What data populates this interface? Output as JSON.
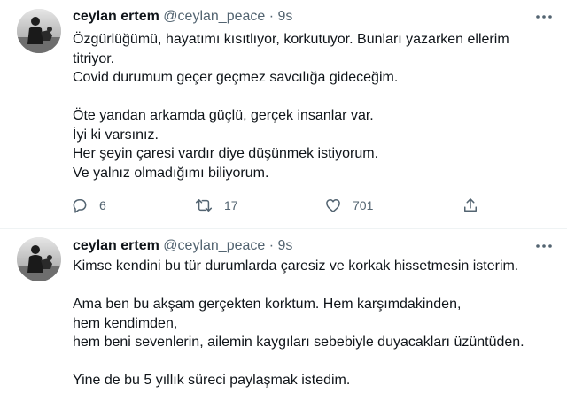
{
  "tweets": [
    {
      "name": "ceylan ertem",
      "handle": "@ceylan_peace",
      "separator": "·",
      "time": "9s",
      "lines": [
        "Özgürlüğümü, hayatımı kısıtlıyor, korkutuyor. Bunları yazarken ellerim",
        "titriyor.",
        "Covid durumum geçer geçmez savcılığa gideceğim.",
        "",
        "Öte yandan arkamda güçlü, gerçek insanlar var.",
        "İyi ki varsınız.",
        "Her şeyin çaresi vardır diye düşünmek istiyorum.",
        "Ve yalnız olmadığımı biliyorum."
      ],
      "actions": {
        "replies": "6",
        "retweets": "17",
        "likes": "701"
      }
    },
    {
      "name": "ceylan ertem",
      "handle": "@ceylan_peace",
      "separator": "·",
      "time": "9s",
      "lines": [
        "Kimse kendini bu tür durumlarda çaresiz ve korkak hissetmesin isterim.",
        "",
        "Ama ben bu akşam gerçekten korktum. Hem karşımdakinden,",
        "hem kendimden,",
        "hem beni sevenlerin, ailemin kaygıları sebebiyle duyacakları üzüntüden.",
        "",
        "Yine de bu 5 yıllık süreci paylaşmak istedim."
      ]
    }
  ],
  "icons": {
    "more": "more-dots-icon",
    "reply": "reply-icon",
    "retweet": "retweet-icon",
    "like": "heart-icon",
    "share": "share-icon"
  },
  "colors": {
    "text": "#0f1419",
    "secondary": "#536471",
    "divider": "#eff3f4"
  }
}
